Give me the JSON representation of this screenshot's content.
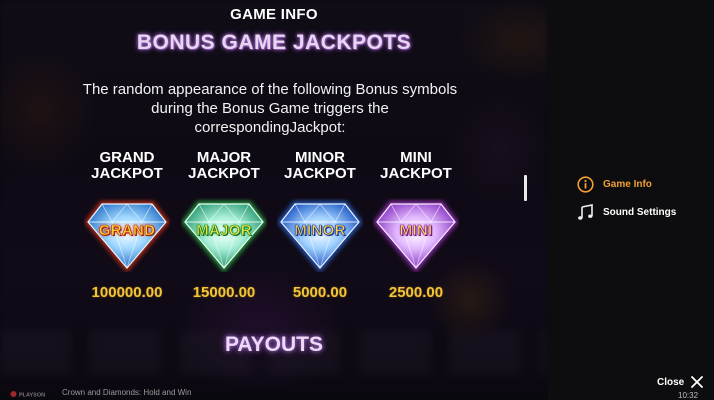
{
  "main": {
    "header_title": "GAME INFO",
    "section_title": "BONUS GAME JACKPOTS",
    "description": "The random appearance of the following Bonus symbols during the Bonus Game triggers the correspondingJackpot:",
    "jackpots": [
      {
        "label_line1": "GRAND",
        "label_line2": "JACKPOT",
        "gem_text": "GRAND",
        "amount": "100000.00",
        "glow": "#e0351a"
      },
      {
        "label_line1": "MAJOR",
        "label_line2": "JACKPOT",
        "gem_text": "MAJOR",
        "amount": "15000.00",
        "glow": "#2ec44a"
      },
      {
        "label_line1": "MINOR",
        "label_line2": "JACKPOT",
        "gem_text": "MINOR",
        "amount": "5000.00",
        "glow": "#2f6fe6"
      },
      {
        "label_line1": "MINI",
        "label_line2": "JACKPOT",
        "gem_text": "MINI",
        "amount": "2500.00",
        "glow": "#b13ad8"
      }
    ],
    "payouts_title": "PAYOUTS"
  },
  "sidebar": {
    "items": [
      {
        "label": "Game Info",
        "icon": "info-icon",
        "active": true
      },
      {
        "label": "Sound Settings",
        "icon": "music-note-icon",
        "active": false
      }
    ],
    "close_label": "Close"
  },
  "footer": {
    "brand": "PLAYSON",
    "game_name": "Crown and Diamonds: Hold and Win",
    "time": "10:32"
  },
  "colors": {
    "accent_orange": "#f0a032",
    "amount_gold": "#f3c53a",
    "sidebar_bg": "#0d0d0f"
  }
}
